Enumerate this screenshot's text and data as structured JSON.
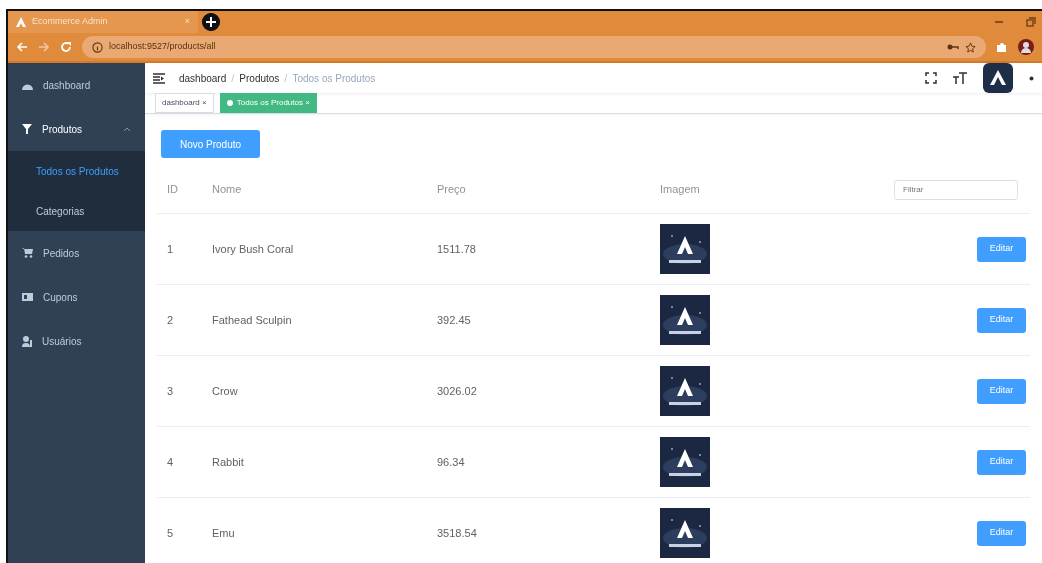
{
  "browser": {
    "tab_title": "Ecommerce Admin",
    "tab_close": "×",
    "url": "localhost:9527/products/all"
  },
  "sidebar": {
    "items": [
      {
        "label": "dashboard",
        "selected": false
      },
      {
        "label": "Produtos",
        "selected": false,
        "expanded": true,
        "children": [
          {
            "label": "Todos os Produtos",
            "selected": true
          },
          {
            "label": "Categorias",
            "selected": false
          }
        ]
      },
      {
        "label": "Pedidos",
        "selected": false
      },
      {
        "label": "Cupons",
        "selected": false
      },
      {
        "label": "Usuários",
        "selected": false
      }
    ]
  },
  "breadcrumb": {
    "items": [
      "dashboard",
      "Produtos",
      "Todos os Produtos"
    ],
    "separator": "/"
  },
  "tags": [
    {
      "label": "dashboard",
      "selected": false,
      "close": "×"
    },
    {
      "label": "Todos os Produtos",
      "selected": true,
      "close": "×"
    }
  ],
  "new_button": "Novo Produto",
  "table": {
    "columns": [
      "ID",
      "Nome",
      "Preço",
      "Imagem"
    ],
    "filter": {
      "placeholder": "Filtrar"
    },
    "rows": [
      {
        "id": "1",
        "name": "Ivory Bush Coral",
        "price": "1511.78",
        "action": "Editar"
      },
      {
        "id": "2",
        "name": "Fathead Sculpin",
        "price": "392.45",
        "action": "Editar"
      },
      {
        "id": "3",
        "name": "Crow",
        "price": "3026.02",
        "action": "Editar"
      },
      {
        "id": "4",
        "name": "Rabbit",
        "price": "96.34",
        "action": "Editar"
      },
      {
        "id": "5",
        "name": "Emu",
        "price": "3518.54",
        "action": "Editar"
      }
    ]
  }
}
